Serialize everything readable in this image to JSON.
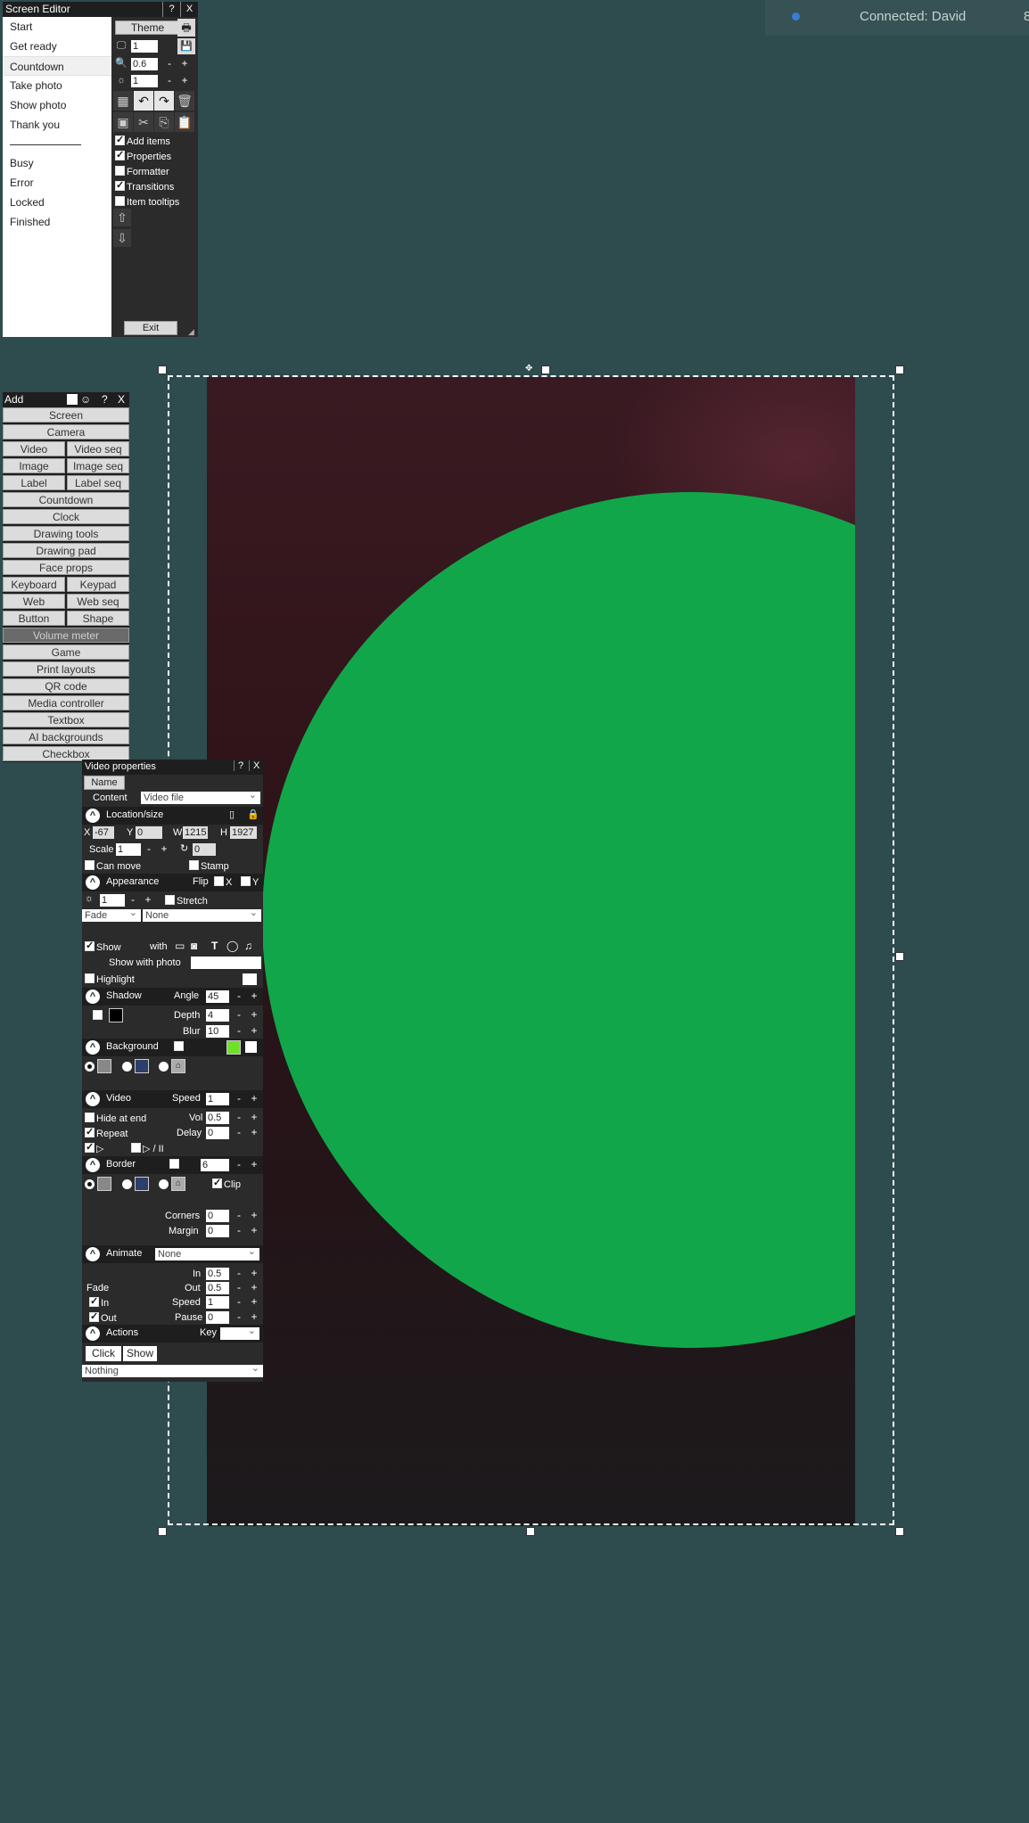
{
  "status": {
    "connected_text": "Connected: David",
    "right_edge_text": "8"
  },
  "screen_editor": {
    "title": "Screen Editor",
    "help": "?",
    "close": "X",
    "theme_label": "Theme",
    "screens": [
      "Start",
      "Get ready",
      "Countdown",
      "Take photo",
      "Show photo",
      "Thank you"
    ],
    "selected_screen": "Countdown",
    "status_screens": [
      "Busy",
      "Error",
      "Locked",
      "Finished"
    ],
    "monitor_value": "1",
    "zoom_value": "0.6",
    "brightness_value": "1",
    "minus": "-",
    "plus": "+",
    "options": [
      {
        "label": "Add items",
        "checked": true
      },
      {
        "label": "Properties",
        "checked": true
      },
      {
        "label": "Formatter",
        "checked": false
      },
      {
        "label": "Transitions",
        "checked": true
      },
      {
        "label": "Item tooltips",
        "checked": false
      }
    ],
    "exit_label": "Exit"
  },
  "add_panel": {
    "title": "Add",
    "help": "?",
    "close": "X",
    "rows": [
      [
        "Screen"
      ],
      [
        "Camera"
      ],
      [
        "Video",
        "Video seq"
      ],
      [
        "Image",
        "Image seq"
      ],
      [
        "Label",
        "Label seq"
      ],
      [
        "Countdown"
      ],
      [
        "Clock"
      ],
      [
        "Drawing tools"
      ],
      [
        "Drawing pad"
      ],
      [
        "Face props"
      ],
      [
        "Keyboard",
        "Keypad"
      ],
      [
        "Web",
        "Web seq"
      ],
      [
        "Button",
        "Shape"
      ],
      [
        "Volume meter"
      ],
      [
        "Game"
      ],
      [
        "Print layouts"
      ],
      [
        "QR code"
      ],
      [
        "Media controller"
      ],
      [
        "Textbox"
      ],
      [
        "AI backgrounds"
      ],
      [
        "Checkbox"
      ]
    ]
  },
  "video_props": {
    "title": "Video properties",
    "help": "?",
    "close": "X",
    "name_label": "Name",
    "content_label": "Content",
    "content_value": "Video file",
    "location_label": "Location/size",
    "x_label": "X",
    "x_value": "-67",
    "y_label": "Y",
    "y_value": "0",
    "w_label": "W",
    "w_value": "1215",
    "h_label": "H",
    "h_value": "1927",
    "scale_label": "Scale",
    "scale_value": "1",
    "rotate_value": "0",
    "can_move_label": "Can move",
    "stamp_label": "Stamp",
    "appearance_label": "Appearance",
    "flip_label": "Flip",
    "flip_x": "X",
    "flip_y": "Y",
    "opacity_value": "1",
    "stretch_label": "Stretch",
    "effect_value": "Fade",
    "effect2_value": "None",
    "show_label": "Show",
    "with_label": "with",
    "show_with_photo_label": "Show with photo",
    "highlight_label": "Highlight",
    "shadow_label": "Shadow",
    "angle_label": "Angle",
    "angle_value": "45",
    "depth_label": "Depth",
    "depth_value": "4",
    "blur_label": "Blur",
    "blur_value": "10",
    "background_label": "Background",
    "bg_accent_color": "#6ee02a",
    "video_label": "Video",
    "speed_label": "Speed",
    "speed_value": "1",
    "hide_at_end_label": "Hide at end",
    "vol_label": "Vol",
    "vol_value": "0.5",
    "repeat_label": "Repeat",
    "delay_label": "Delay",
    "delay_value": "0",
    "play_pause_label": "▷ / II",
    "border_label": "Border",
    "border_value": "6",
    "clip_label": "Clip",
    "corners_label": "Corners",
    "corners_value": "0",
    "margin_label": "Margin",
    "margin_value": "0",
    "animate_label": "Animate",
    "animate_value": "None",
    "in_label": "In",
    "in_value": "0.5",
    "out_label": "Out",
    "out_value": "0.5",
    "fade_label": "Fade",
    "fade_in_label": "In",
    "fade_out_label": "Out",
    "speed2_value": "1",
    "pause_label": "Pause",
    "pause_value": "0",
    "actions_label": "Actions",
    "key_label": "Key",
    "click_tab": "Click",
    "show_tab": "Show",
    "action_value": "Nothing"
  },
  "canvas": {
    "circle_color": "#12a64a"
  }
}
